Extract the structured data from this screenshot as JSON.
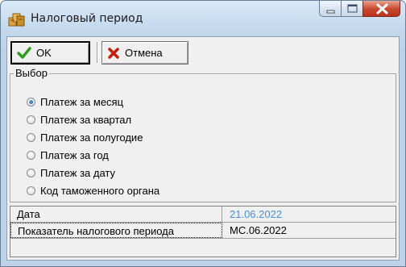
{
  "window": {
    "title": "Налоговый период"
  },
  "toolbar": {
    "ok_label": "OK",
    "cancel_label": "Отмена"
  },
  "choice": {
    "title": "Выбор",
    "options": [
      {
        "label": "Платеж за месяц",
        "checked": true
      },
      {
        "label": "Платеж за квартал",
        "checked": false
      },
      {
        "label": "Платеж за полугодие",
        "checked": false
      },
      {
        "label": "Платеж за год",
        "checked": false
      },
      {
        "label": "Платеж за дату",
        "checked": false
      },
      {
        "label": "Код таможенного органа",
        "checked": false
      }
    ]
  },
  "grid": {
    "rows": [
      {
        "label": "Дата",
        "value": "21.06.2022",
        "value_color": "#4a90d9"
      },
      {
        "label": "Показатель налогового периода",
        "value": "МС.06.2022",
        "value_color": "#000000"
      }
    ]
  },
  "colors": {
    "accent": "#4a90d9",
    "close_button": "#c8462e"
  }
}
